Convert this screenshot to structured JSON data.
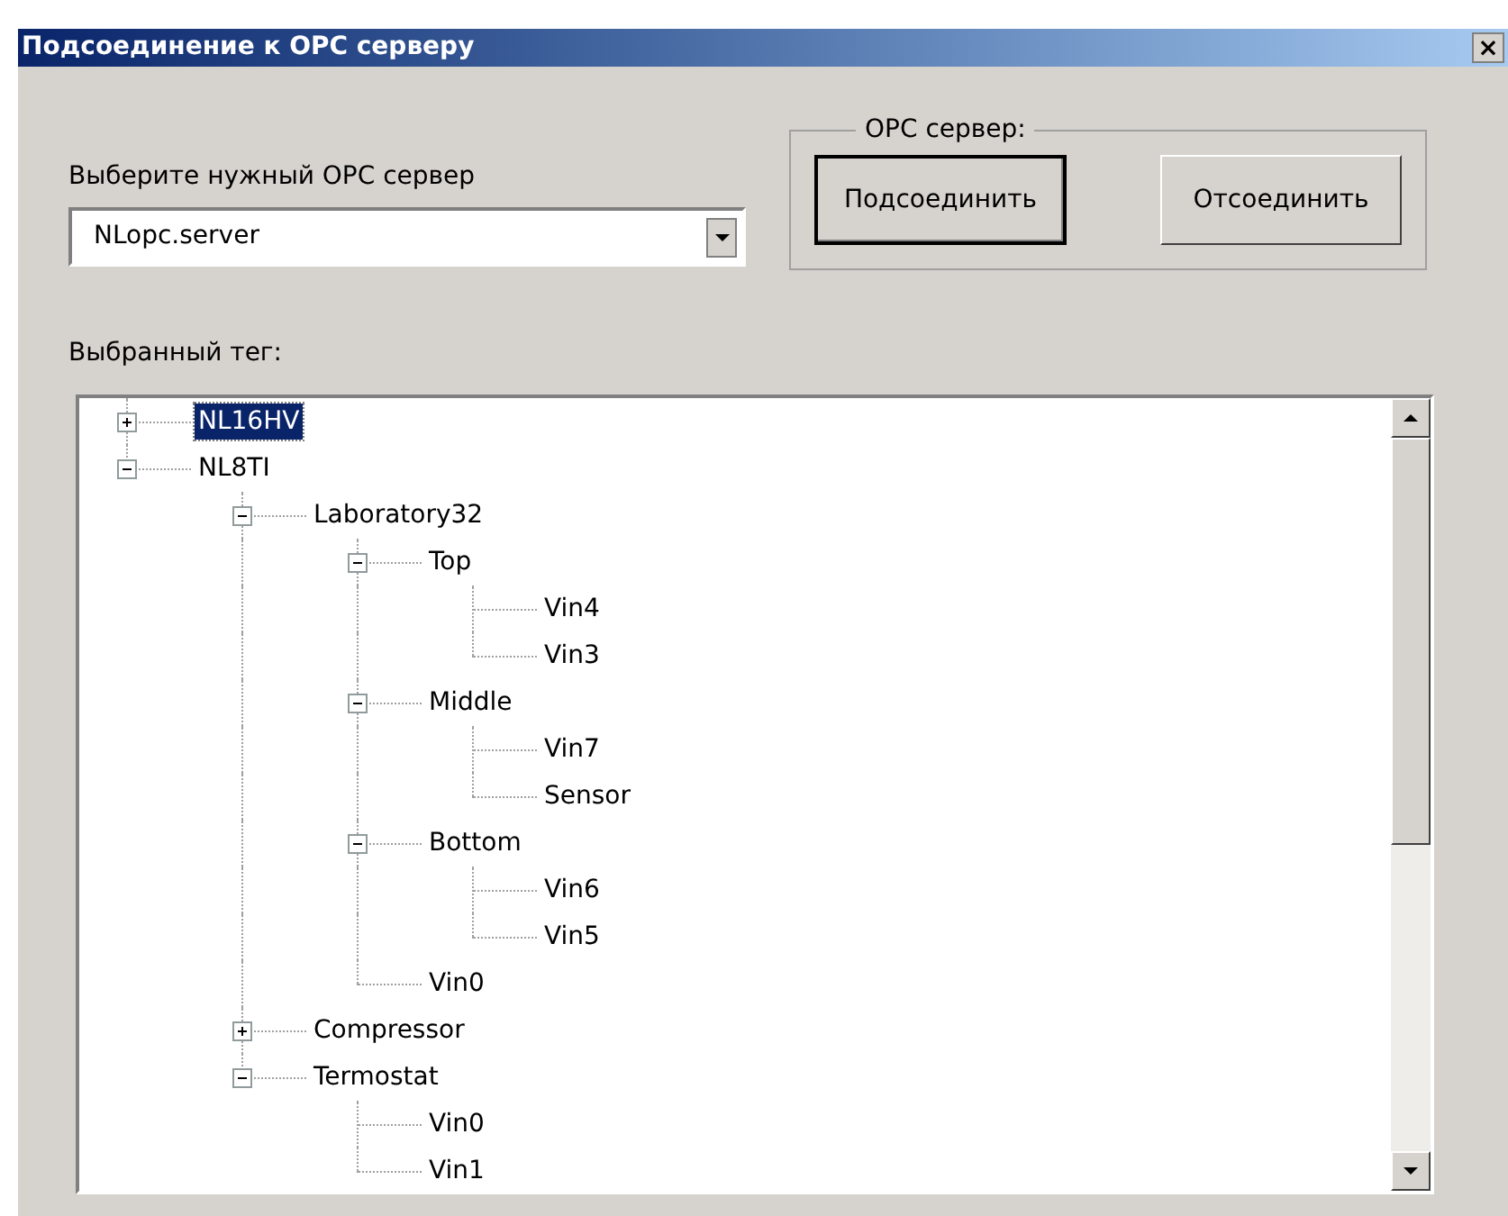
{
  "window": {
    "title": "Подсоединение к OPC серверу",
    "close": "×"
  },
  "server_select": {
    "label": "Выберите нужный OPC сервер",
    "value": "NLopc.server"
  },
  "server_group": {
    "title": "OPC сервер:",
    "buttons": [
      {
        "label": "Подсоединить",
        "default": true
      },
      {
        "label": "Отсоединить",
        "default": false
      }
    ]
  },
  "tree": {
    "label": "Выбранный тег:",
    "items": [
      {
        "label": "NL16HV",
        "kind": "group",
        "expanded": false,
        "selected": true
      },
      {
        "label": "NL8TI",
        "kind": "group",
        "expanded": true,
        "selected": false,
        "children": [
          {
            "label": "Laboratory32",
            "kind": "group",
            "expanded": true,
            "selected": false,
            "children": [
              {
                "label": "Top",
                "kind": "group",
                "expanded": true,
                "selected": false,
                "children": [
                  {
                    "label": "Vin4",
                    "kind": "tag",
                    "selected": false
                  },
                  {
                    "label": "Vin3",
                    "kind": "tag",
                    "selected": false
                  }
                ]
              },
              {
                "label": "Middle",
                "kind": "group",
                "expanded": true,
                "selected": false,
                "children": [
                  {
                    "label": "Vin7",
                    "kind": "tag",
                    "selected": false
                  },
                  {
                    "label": "Sensor",
                    "kind": "tag",
                    "selected": false
                  }
                ]
              },
              {
                "label": "Bottom",
                "kind": "group",
                "expanded": true,
                "selected": false,
                "children": [
                  {
                    "label": "Vin6",
                    "kind": "tag",
                    "selected": false
                  },
                  {
                    "label": "Vin5",
                    "kind": "tag",
                    "selected": false
                  }
                ]
              },
              {
                "label": "Vin0",
                "kind": "tag",
                "selected": false
              }
            ]
          },
          {
            "label": "Compressor",
            "kind": "group",
            "expanded": false,
            "selected": false
          },
          {
            "label": "Termostat",
            "kind": "group",
            "expanded": true,
            "selected": false,
            "children": [
              {
                "label": "Vin0",
                "kind": "tag",
                "selected": false
              },
              {
                "label": "Vin1",
                "kind": "tag",
                "selected": false
              }
            ]
          }
        ]
      }
    ]
  }
}
